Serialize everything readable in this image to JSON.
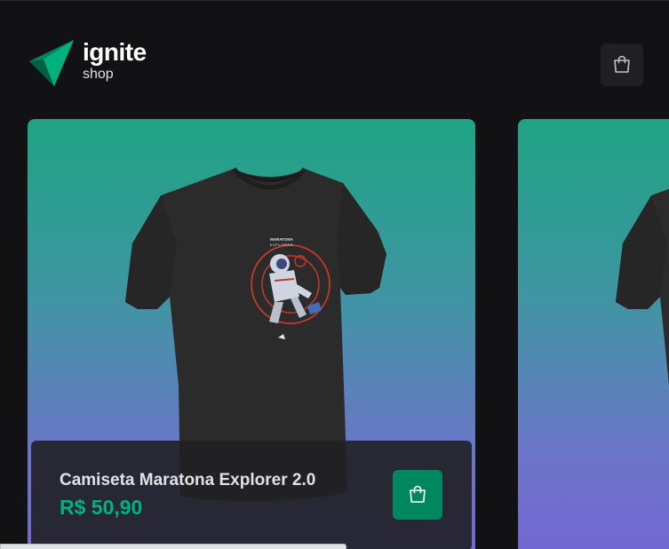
{
  "header": {
    "logo_title": "ignite",
    "logo_subtitle": "shop"
  },
  "products": [
    {
      "name": "Camiseta Maratona Explorer 2.0",
      "price": "R$ 50,90",
      "print_text_top": "MARATONA",
      "print_text_bottom": "EXPLORER"
    }
  ],
  "colors": {
    "background": "#121214",
    "card_gradient_start": "#1ea483",
    "card_gradient_end": "#7465d4",
    "price": "#00b37e",
    "button": "#00875f"
  },
  "icons": {
    "cart": "shopping-bag-icon",
    "add_to_cart": "shopping-bag-icon"
  }
}
